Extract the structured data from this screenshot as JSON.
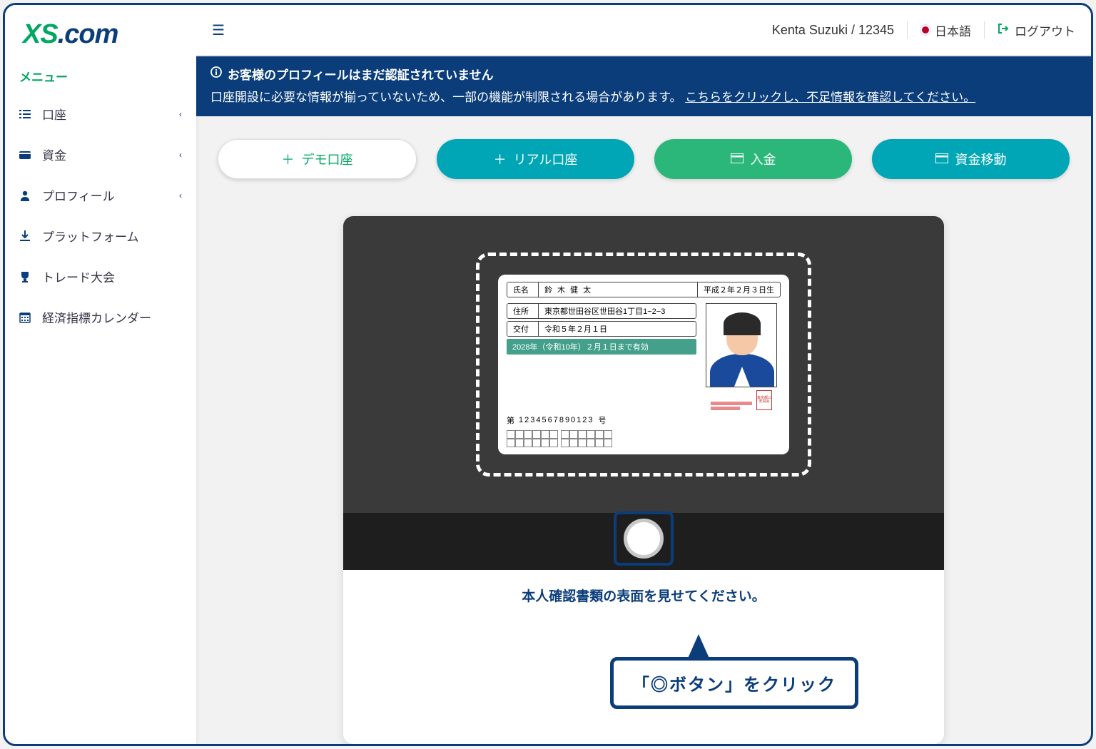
{
  "logo": {
    "part1": "XS",
    "part2": ".com"
  },
  "sidebar": {
    "menu_title": "メニュー",
    "items": [
      {
        "label": "口座",
        "expandable": true
      },
      {
        "label": "資金",
        "expandable": true
      },
      {
        "label": "プロフィール",
        "expandable": true
      },
      {
        "label": "プラットフォーム",
        "expandable": false
      },
      {
        "label": "トレード大会",
        "expandable": false
      },
      {
        "label": "経済指標カレンダー",
        "expandable": false
      }
    ]
  },
  "header": {
    "user": "Kenta Suzuki / 12345",
    "language": "日本語",
    "logout": "ログアウト"
  },
  "alert": {
    "title": "お客様のプロフィールはまだ認証されていません",
    "body_pre": "口座開設に必要な情報が揃っていないため、一部の機能が制限される場合があります。 ",
    "body_link": "こちらをクリックし、不足情報を確認してください。"
  },
  "actions": {
    "demo": "デモ口座",
    "real": "リアル口座",
    "deposit": "入金",
    "transfer": "資金移動"
  },
  "id_card": {
    "name_label": "氏名",
    "name_value": "鈴 木 健 太",
    "dob": "平成２年２月３日生",
    "addr_label": "住所",
    "addr_value": "東京都世田谷区世田谷1丁目1−2−3",
    "issue_label": "交付",
    "issue_value": "令和５年２月１日",
    "valid_until": "2028年（令和10年）２月１日まで有効",
    "num_pre": "第",
    "num": "1234567890123",
    "num_suf": "号",
    "seal": "東京都公安員会"
  },
  "instruction": "本人確認書類の表面を見せてください。",
  "callout": "「◎ボタン」をクリック"
}
